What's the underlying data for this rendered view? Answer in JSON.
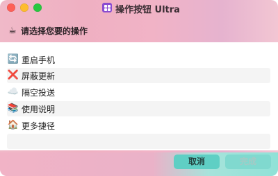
{
  "window": {
    "title": "操作按钮 Ultra"
  },
  "header": {
    "icon": "coffee-icon",
    "icon_glyph": "☕",
    "prompt": "请选择您要的操作"
  },
  "actions": [
    {
      "icon": "restart-icon",
      "glyph": "🔄",
      "label": "重启手机"
    },
    {
      "icon": "cross-mark-icon",
      "glyph": "❌",
      "label": "屏蔽更新"
    },
    {
      "icon": "cloud-icon",
      "glyph": "☁️",
      "label": "隔空投送"
    },
    {
      "icon": "books-icon",
      "glyph": "📚",
      "label": "使用说明"
    },
    {
      "icon": "house-icon",
      "glyph": "🏠",
      "label": "更多捷径"
    }
  ],
  "buttons": {
    "cancel": "取消",
    "done": "完成"
  }
}
